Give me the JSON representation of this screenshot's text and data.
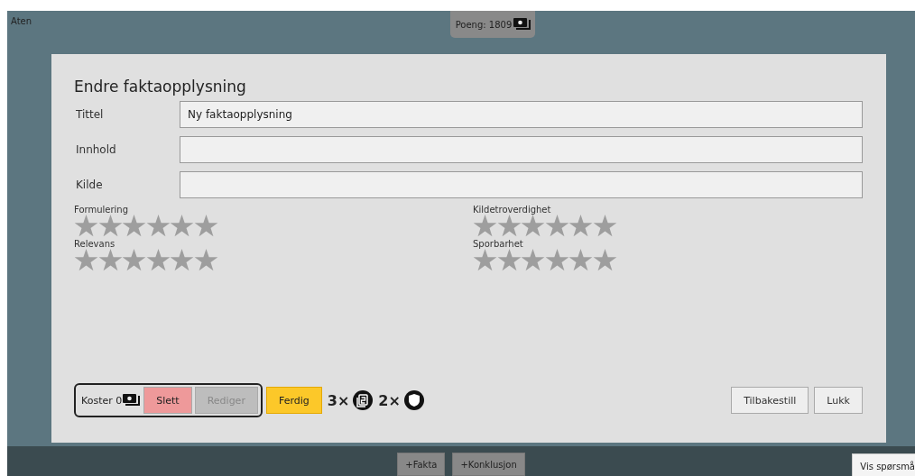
{
  "header": {
    "player": "Aten",
    "points": "Poeng: 1809"
  },
  "dialog": {
    "title": "Endre faktaopplysning",
    "fields": [
      {
        "label": "Tittel",
        "value": "Ny faktaopplysning"
      },
      {
        "label": "Innhold"
      },
      {
        "label": "Kilde"
      }
    ],
    "ratings": [
      {
        "label": "Formulering",
        "stars": 0
      },
      {
        "label": "Kildetroverdighet",
        "stars": 0
      },
      {
        "label": "Relevans",
        "stars": 0
      },
      {
        "label": "Sporbarhet",
        "stars": 0
      }
    ],
    "cost": "Koster 0",
    "actions": [
      {
        "label": "Slett",
        "kind": "delete",
        "disabled": false
      },
      {
        "label": "Rediger",
        "kind": "edit",
        "disabled": true
      }
    ],
    "done": "Ferdig",
    "inventory": [
      {
        "count": "3×",
        "kind": "card"
      },
      {
        "count": "2×",
        "kind": "shield"
      }
    ],
    "buttons": [
      "Tilbakestill",
      "Lukk"
    ]
  },
  "bottom_bar": {
    "buttons": [
      "+Fakta",
      "+Konklusjon"
    ],
    "help": "Vis spørsmå"
  }
}
